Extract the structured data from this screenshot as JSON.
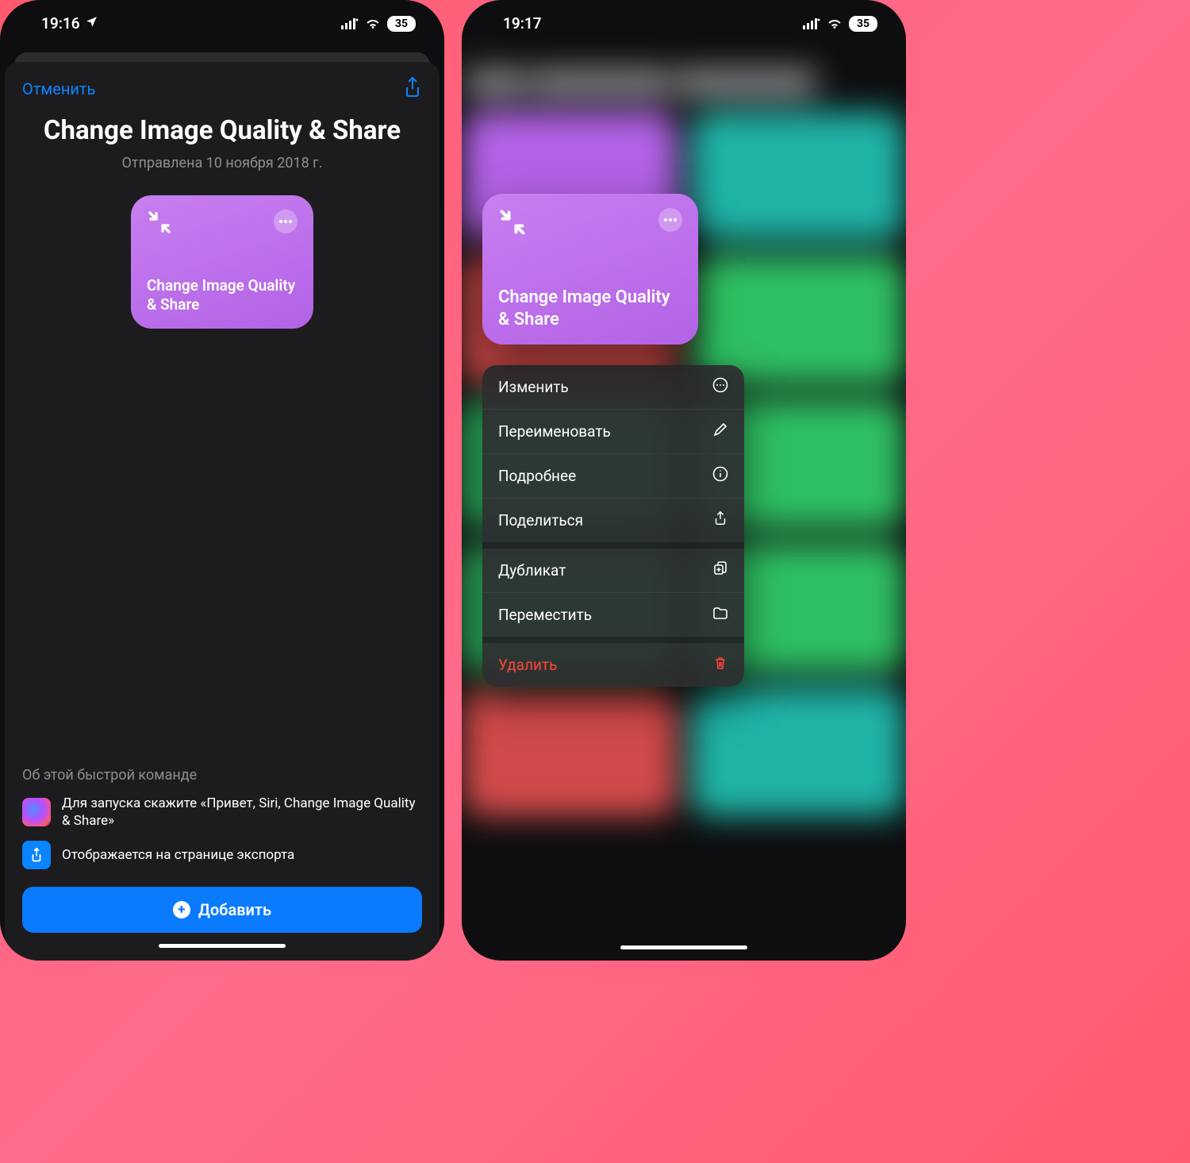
{
  "left": {
    "status": {
      "time": "19:16",
      "battery": "35"
    },
    "sheet": {
      "cancel": "Отменить",
      "title": "Change Image Quality & Share",
      "subtitle": "Отправлена 10 ноября 2018 г.",
      "tile_label": "Change Image Quality & Share",
      "about_heading": "Об этой быстрой команде",
      "siri_text": "Для запуска скажите «Привет, Siri, Change Image Quality & Share»",
      "export_text": "Отображается на странице экспорта",
      "add_label": "Добавить"
    }
  },
  "right": {
    "status": {
      "time": "19:17",
      "battery": "35"
    },
    "tile_label": "Change Image Quality & Share",
    "menu": {
      "edit": "Изменить",
      "rename": "Переименовать",
      "details": "Подробнее",
      "share": "Поделиться",
      "duplicate": "Дубликат",
      "move": "Переместить",
      "delete": "Удалить"
    }
  }
}
